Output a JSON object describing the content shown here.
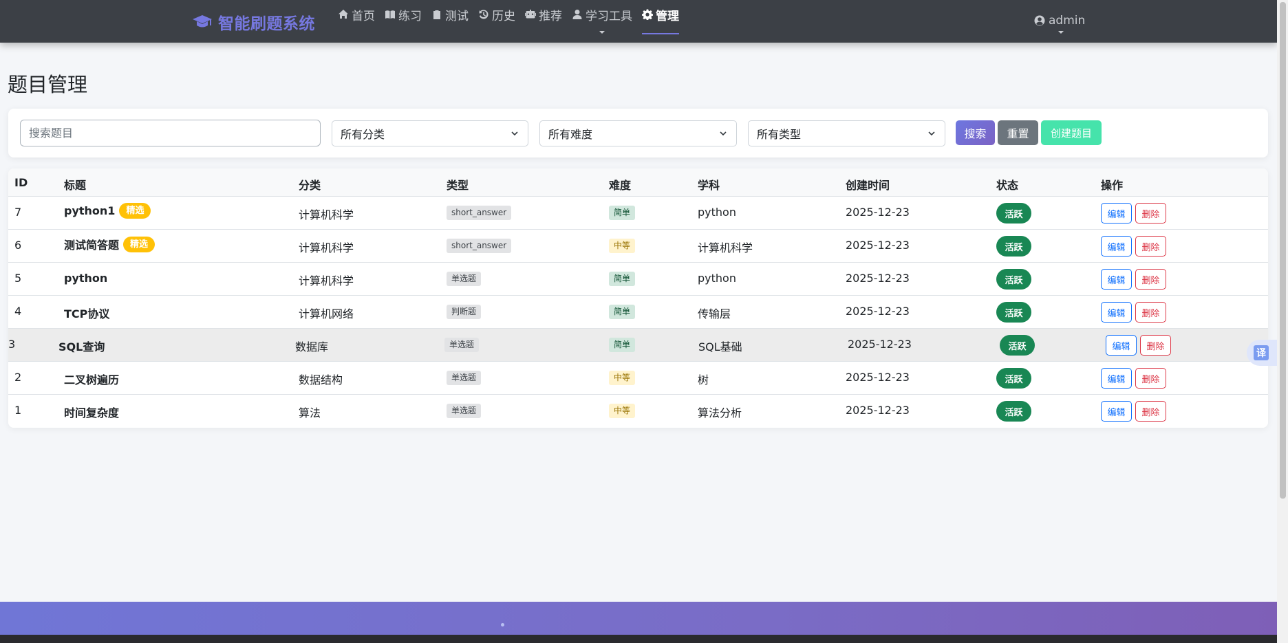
{
  "brand": {
    "name": "智能刷题系统"
  },
  "nav": {
    "items": [
      {
        "label": "首页",
        "icon": "home-icon"
      },
      {
        "label": "练习",
        "icon": "book-icon"
      },
      {
        "label": "测试",
        "icon": "clipboard-icon"
      },
      {
        "label": "历史",
        "icon": "history-icon"
      },
      {
        "label": "推荐",
        "icon": "robot-icon"
      },
      {
        "label": "学习工具",
        "icon": "user-icon",
        "dropdown": true
      },
      {
        "label": "管理",
        "icon": "gear-icon",
        "active": true
      }
    ],
    "user": {
      "name": "admin",
      "icon": "user-circle-icon"
    }
  },
  "page": {
    "title": "题目管理"
  },
  "filters": {
    "search_placeholder": "搜索题目",
    "category": "所有分类",
    "difficulty": "所有难度",
    "type": "所有类型",
    "search_btn": "搜索",
    "reset_btn": "重置",
    "create_btn": "创建题目"
  },
  "table": {
    "headers": {
      "id": "ID",
      "title": "标题",
      "category": "分类",
      "type": "类型",
      "difficulty": "难度",
      "subject": "学科",
      "created": "创建时间",
      "status": "状态",
      "actions": "操作"
    },
    "edit_label": "编辑",
    "delete_label": "删除",
    "rows": [
      {
        "id": "7",
        "title": "python1",
        "featured": "精选",
        "category": "计算机科学",
        "type": "short_answer",
        "difficulty": "简单",
        "subject": "python",
        "created": "2025-12-23",
        "status": "活跃"
      },
      {
        "id": "6",
        "title": "测试简答题",
        "featured": "精选",
        "category": "计算机科学",
        "type": "short_answer",
        "difficulty": "中等",
        "subject": "计算机科学",
        "created": "2025-12-23",
        "status": "活跃"
      },
      {
        "id": "5",
        "title": "python",
        "featured": "",
        "category": "计算机科学",
        "type": "单选题",
        "difficulty": "简单",
        "subject": "python",
        "created": "2025-12-23",
        "status": "活跃"
      },
      {
        "id": "4",
        "title": "TCP协议",
        "featured": "",
        "category": "计算机网络",
        "type": "判断题",
        "difficulty": "简单",
        "subject": "传输层",
        "created": "2025-12-23",
        "status": "活跃"
      },
      {
        "id": "3",
        "title": "SQL查询",
        "featured": "",
        "category": "数据库",
        "type": "单选题",
        "difficulty": "简单",
        "subject": "SQL基础",
        "created": "2025-12-23",
        "status": "活跃"
      },
      {
        "id": "2",
        "title": "二叉树遍历",
        "featured": "",
        "category": "数据结构",
        "type": "单选题",
        "difficulty": "中等",
        "subject": "树",
        "created": "2025-12-23",
        "status": "活跃"
      },
      {
        "id": "1",
        "title": "时间复杂度",
        "featured": "",
        "category": "算法",
        "type": "单选题",
        "difficulty": "中等",
        "subject": "算法分析",
        "created": "2025-12-23",
        "status": "活跃"
      }
    ]
  },
  "translate": {
    "label": "译"
  },
  "colors": {
    "navbar": "#3c4046",
    "brand": "#7678e0",
    "primary": "#7678e0",
    "secondary": "#6c757d",
    "create": "#46e3ab",
    "success": "#198754",
    "featured": "#ffc107",
    "danger": "#dc3545",
    "link": "#0d6efd"
  }
}
